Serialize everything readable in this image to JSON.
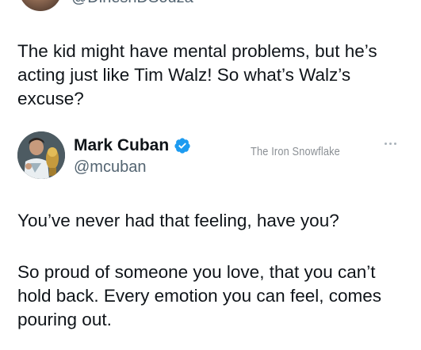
{
  "top_tweet": {
    "handle": "@DineshDSouza",
    "text": "The kid might have mental problems, but he’s acting just like Tim Walz! So what’s Walz’s excuse?"
  },
  "quoted_tweet": {
    "name": "Mark Cuban",
    "handle": "@mcuban",
    "verified": true,
    "avatar_icon": "avatar-photo-icon",
    "verified_icon": "verified-badge-icon",
    "more_icon": "more-options-icon",
    "paragraph_1": "You’ve never had that feeling, have you?",
    "paragraph_2": "So proud of someone you love, that you can’t hold back.  Every emotion you can feel, comes pouring out."
  },
  "watermark": "The Iron Snowflake",
  "colors": {
    "text": "#0f1419",
    "secondary": "#536471",
    "verified": "#1d9bf0",
    "background": "#ffffff"
  }
}
